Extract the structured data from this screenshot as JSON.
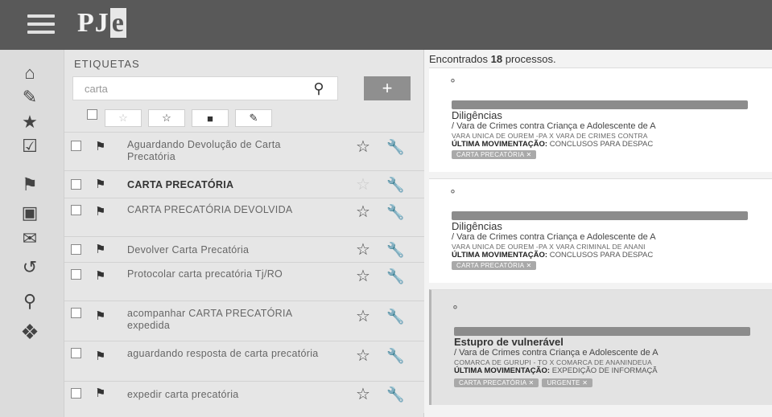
{
  "app": {
    "logo_main": "PJ",
    "logo_accent": "e"
  },
  "tags_panel": {
    "title": "ETIQUETAS",
    "search_value": "carta",
    "search_icon": "search-icon",
    "add_label": "+",
    "filters": [
      "☆",
      "☆",
      "■",
      "✎"
    ],
    "items": [
      {
        "label": "Aguardando Devolução de Carta Precatória",
        "bold": false,
        "star_dim": false
      },
      {
        "label": "CARTA PRECATÓRIA",
        "bold": true,
        "star_dim": true
      },
      {
        "label": "CARTA PRECATÓRIA DEVOLVIDA",
        "bold": false,
        "star_dim": false
      },
      {
        "label": "Devolver Carta Precatória",
        "bold": false,
        "star_dim": false
      },
      {
        "label": "Protocolar carta precatória Tj/RO",
        "bold": false,
        "star_dim": false
      },
      {
        "label": "acompanhar CARTA PRECATÓRIA expedida",
        "bold": false,
        "star_dim": false
      },
      {
        "label": "aguardando resposta de carta precatória",
        "bold": false,
        "star_dim": false
      },
      {
        "label": "expedir carta precatória",
        "bold": false,
        "star_dim": false
      }
    ]
  },
  "results": {
    "count_prefix": "Encontrados",
    "count_value": "18",
    "count_suffix": "processos.",
    "cards": [
      {
        "classe": "Diligências",
        "line1": "/ Vara de Crimes contra Criança e Adolescente de A",
        "line2": "VARA UNICA DE OUREM -PA X VARA DE CRIMES CONTRA",
        "mov_label": "ÚLTIMA MOVIMENTAÇÃO:",
        "mov_value": "CONCLUSOS PARA DESPAC",
        "chips": [
          "CARTA PRECATÓRIA ✕"
        ],
        "selected": false,
        "bold_class": false
      },
      {
        "classe": "Diligências",
        "line1": "/ Vara de Crimes contra Criança e Adolescente de A",
        "line2": "VARA UNICA DE OUREM -PA X VARA CRIMINAL DE ANANI",
        "mov_label": "ÚLTIMA MOVIMENTAÇÃO:",
        "mov_value": "CONCLUSOS PARA DESPAC",
        "chips": [
          "CARTA PRECATÓRIA ✕"
        ],
        "selected": false,
        "bold_class": false
      },
      {
        "classe": "Estupro de vulnerável",
        "line1": "/ Vara de Crimes contra Criança e Adolescente de A",
        "line2": "COMARCA DE GURUPI - TO X COMARCA DE ANANINDEUA",
        "mov_label": "ÚLTIMA MOVIMENTAÇÃO:",
        "mov_value": "EXPEDIÇÃO DE INFORMAÇÃ",
        "chips": [
          "CARTA PRECATÓRIA ✕",
          "URGENTE ✕"
        ],
        "selected": true,
        "bold_class": true
      }
    ]
  }
}
